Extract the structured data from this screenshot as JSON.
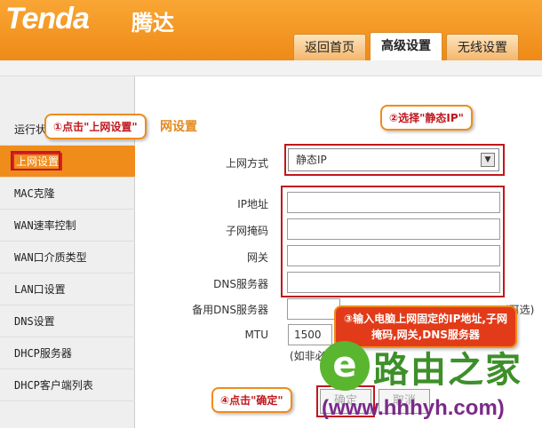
{
  "header": {
    "logo": "Tenda",
    "logo_cn": "腾达",
    "tabs": [
      "返回首页",
      "高级设置",
      "无线设置"
    ]
  },
  "sidebar": {
    "items": [
      "运行状",
      "上网设置",
      "MAC克隆",
      "WAN速率控制",
      "WAN口介质类型",
      "LAN口设置",
      "DNS设置",
      "DHCP服务器",
      "DHCP客户端列表"
    ]
  },
  "main": {
    "title": "网设置",
    "conn_label": "上网方式",
    "conn_value": "静态IP",
    "ip_label": "IP地址",
    "mask_label": "子网掩码",
    "gateway_label": "网关",
    "dns_label": "DNS服务器",
    "dns2_label": "备用DNS服务器",
    "dns2_suffix": "(可选)",
    "mtu_label": "MTU",
    "mtu_value": "1500",
    "mtu_note": "(如非必"
  },
  "buttons": {
    "ok": "确定",
    "cancel": "取消"
  },
  "callouts": {
    "step1": "①点击\"上网设置\"",
    "step2": "②选择\"静态IP\"",
    "step3": "③输入电脑上网固定的IP地址,子网掩码,网关,DNS服务器",
    "step4": "④点击\"确定\""
  },
  "watermark": {
    "text": "路由之家",
    "url": "(www.hhhyh.com)"
  },
  "colors": {
    "orange": "#f08c1a",
    "red": "#c0171d"
  }
}
